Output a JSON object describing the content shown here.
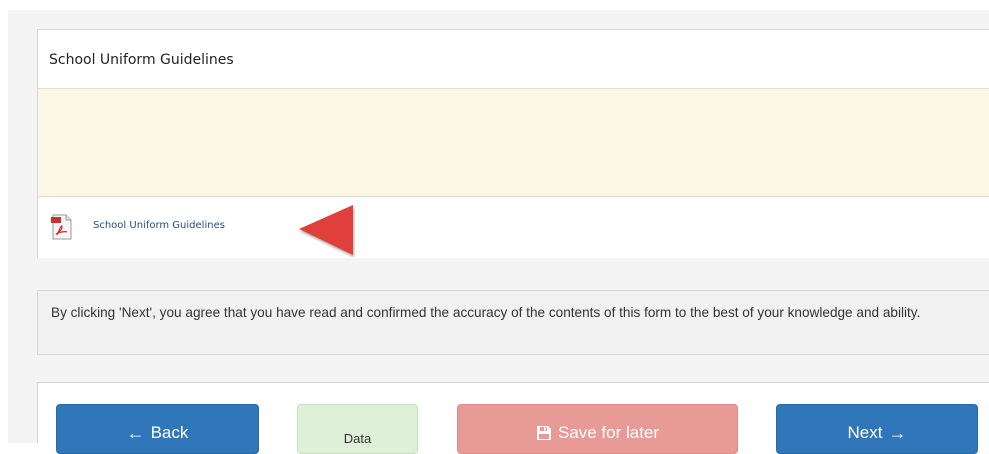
{
  "document_panel": {
    "title": "School Uniform Guidelines",
    "attachment": {
      "label": "School Uniform Guidelines",
      "icon": "pdf-icon"
    },
    "annotation_icon": "red-pointer-arrow"
  },
  "agreement": {
    "text": "By clicking 'Next', you agree that you have read and confirmed the accuracy of the contents of this form to the best of your knowledge and ability."
  },
  "buttons": {
    "back_label": "Back",
    "back_icon": "arrow-left-icon",
    "data_label": "Data",
    "save_label": "Save for later",
    "save_icon": "save-icon",
    "next_label": "Next",
    "next_icon": "arrow-right-icon"
  },
  "colors": {
    "primary_button": "#2f77b8",
    "save_button": "#e89a97",
    "data_button": "#dff0d8",
    "doc_body_background": "#fcf6e4",
    "pointer_arrow": "#e0403a",
    "link": "#1f4e8a"
  }
}
